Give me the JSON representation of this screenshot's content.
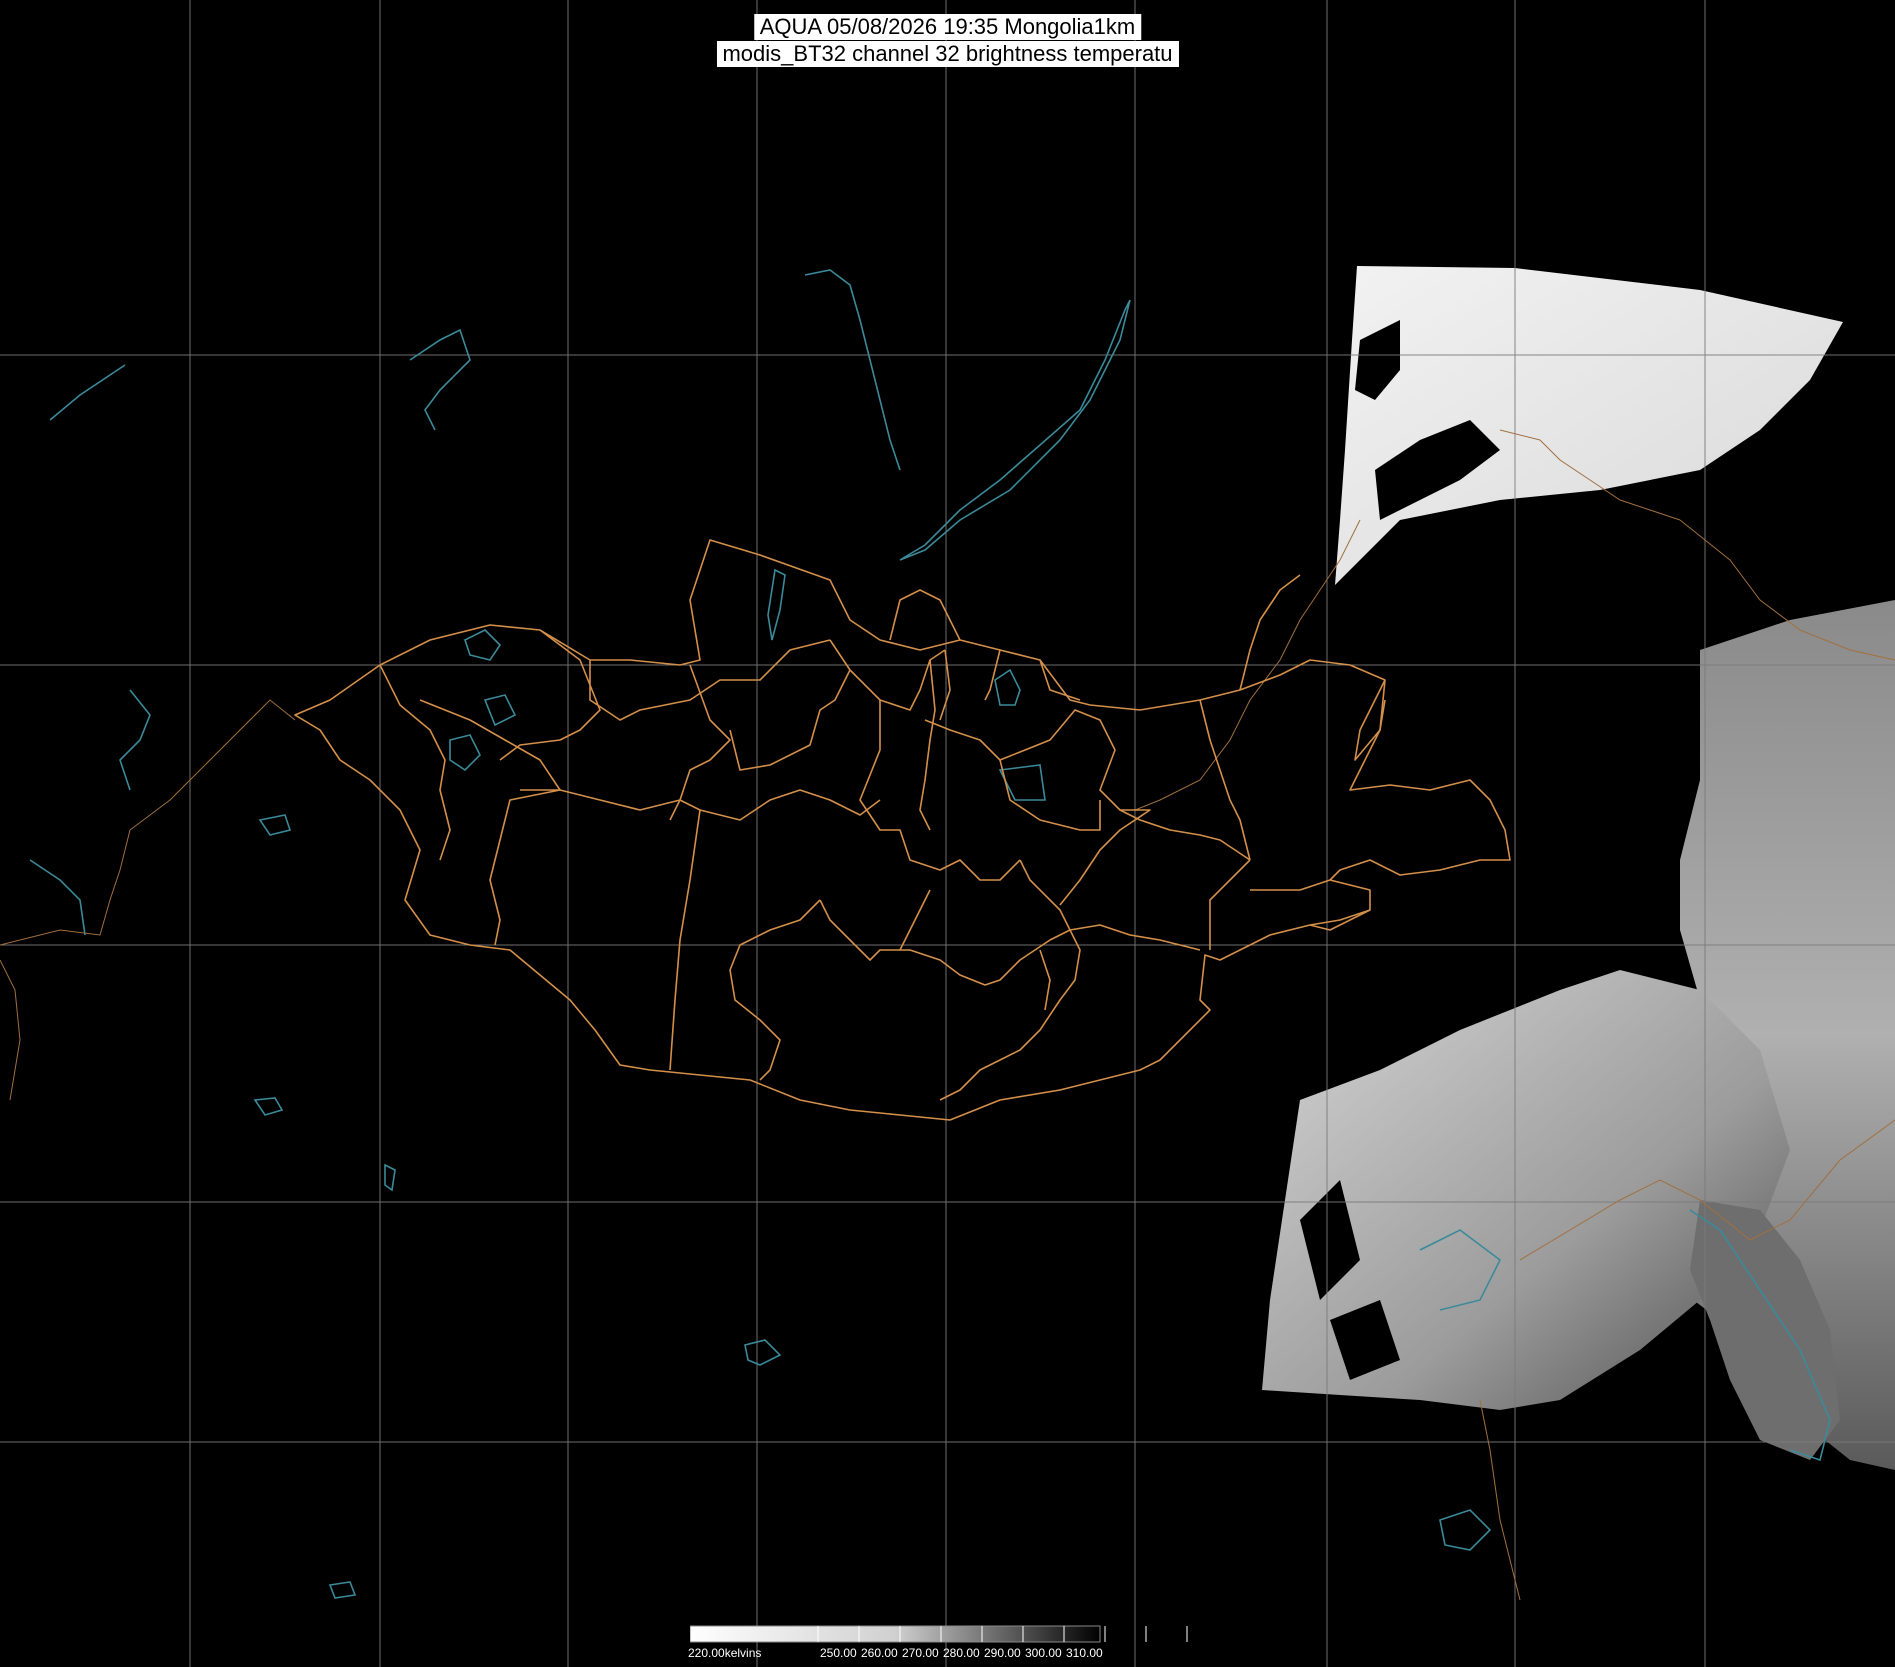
{
  "title": {
    "line1": "AQUA 05/08/2026 19:35 Mongolia1km",
    "line2": "modis_BT32 channel 32 brightness temperatu"
  },
  "colorbar": {
    "unit_label": "220.00kelvins",
    "ticks": [
      "250.00",
      "260.00",
      "270.00",
      "280.00",
      "290.00",
      "300.00",
      "310.00"
    ],
    "range": [
      220,
      320
    ]
  },
  "colors": {
    "background": "#000000",
    "grid": "#7a7a7a",
    "province_boundary": "#d4904a",
    "water": "#3b8a9a"
  }
}
